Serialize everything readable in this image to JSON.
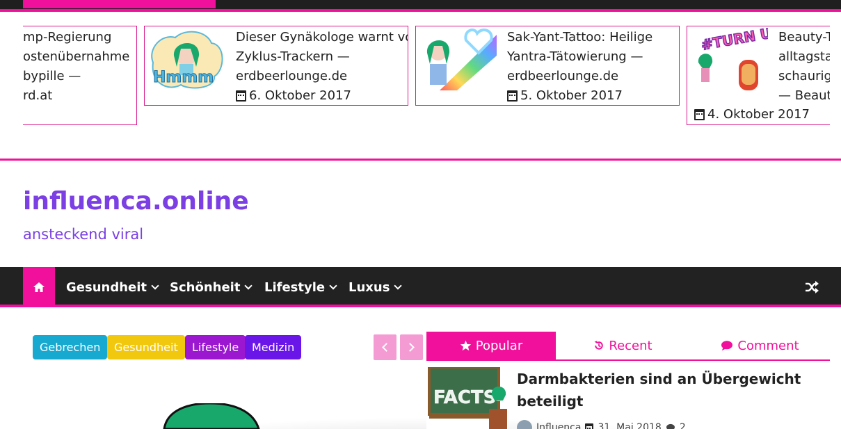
{
  "topbar": {
    "accent": "#f0109b"
  },
  "ticker": {
    "cards": [
      {
        "lines": [
          "mp-Regierung",
          "ostenübernahme",
          "bypille —",
          "rd.at"
        ],
        "date": ""
      },
      {
        "lines": [
          "Dieser Gynäkologe warnt vor",
          "Zyklus-Trackern —",
          "erdbeerlounge.de"
        ],
        "date": "6. Oktober 2017",
        "thumb_text": "Hmmm"
      },
      {
        "lines": [
          "Sak-Yant-Tattoo: Heilige",
          "Yantra-Tätowierung —",
          "erdbeerlounge.de"
        ],
        "date": "5. Oktober 2017"
      },
      {
        "lines": [
          "Beauty-T",
          "alltagstau",
          "schaurig",
          "— Beauty"
        ],
        "date": "4. Oktober 2017",
        "thumb_text": "#TURN UP!"
      }
    ]
  },
  "site": {
    "title": "influenca.online",
    "tagline": "ansteckend viral",
    "brand_color": "#7b3fe4"
  },
  "nav": {
    "home_icon": "home-icon",
    "items": [
      {
        "label": "Gesundheit"
      },
      {
        "label": "Schönheit"
      },
      {
        "label": "Lifestyle"
      },
      {
        "label": "Luxus"
      }
    ],
    "shuffle_icon": "shuffle-icon"
  },
  "tags": [
    {
      "label": "Gebrechen",
      "color": "#18a9d0"
    },
    {
      "label": "Gesundheit",
      "color": "#f2c80f"
    },
    {
      "label": "Lifestyle",
      "color": "#9b18d0"
    },
    {
      "label": "Medizin",
      "color": "#6a16e8"
    }
  ],
  "tabs": [
    {
      "label": "Popular",
      "icon": "star-icon"
    },
    {
      "label": "Recent",
      "icon": "history-icon"
    },
    {
      "label": "Comment",
      "icon": "comment-icon"
    }
  ],
  "popular_post": {
    "title_line1": "Darmbakterien sind an Übergewicht",
    "title_line2": "beteiligt",
    "thumb_text": "FACTS",
    "author": "Influenca",
    "date": "31. Mai 2018",
    "comments": "2"
  }
}
